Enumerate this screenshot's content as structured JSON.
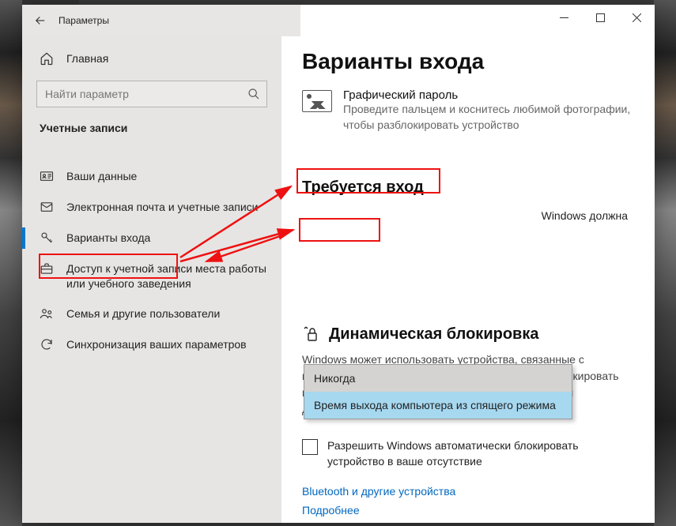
{
  "app_title": "Параметры",
  "home": "Главная",
  "search_placeholder": "Найти параметр",
  "section": "Учетные записи",
  "nav": [
    {
      "label": "Ваши данные"
    },
    {
      "label": "Электронная почта и учетные записи"
    },
    {
      "label": "Варианты входа",
      "active": true
    },
    {
      "label": "Доступ к учетной записи места работы или учебного заведения"
    },
    {
      "label": "Семья и другие пользователи"
    },
    {
      "label": "Синхронизация ваших параметров"
    }
  ],
  "page_title": "Варианты входа",
  "picture_password": {
    "title": "Графический пароль",
    "desc": "Проведите пальцем и коснитесь любимой фотографии, чтобы разблокировать устройство"
  },
  "require_signin": {
    "heading": "Требуется вход",
    "trail_text": "Windows должна",
    "options": [
      "Никогда",
      "Время выхода компьютера из спящего режима"
    ]
  },
  "dynamic_lock": {
    "heading": "Динамическая блокировка",
    "para": "Windows может использовать устройства, связанные с компьютером, чтобы определить отсутствие и заблокировать компьютер, когда эти устройства выйдут за пределы допустимого диапазона.",
    "checkbox_label": "Разрешить Windows автоматически блокировать устройство в ваше отсутствие"
  },
  "links": {
    "bluetooth": "Bluetooth и другие устройства",
    "more": "Подробнее"
  }
}
